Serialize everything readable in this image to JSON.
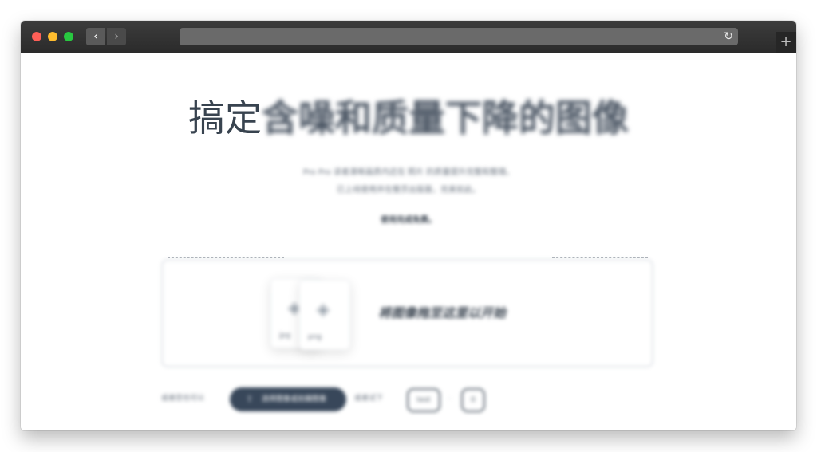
{
  "browser": {
    "back_glyph": "‹",
    "forward_glyph": "›",
    "reload_glyph": "↻",
    "new_tab_glyph": "+",
    "colors": {
      "close": "#fe5f57",
      "minimize": "#febc2e",
      "zoom": "#28c840",
      "titlebar": "#2b2b2b"
    }
  },
  "page": {
    "headline_strong": "搞定",
    "headline_soft": "含噪和质量下降的图像",
    "subtitle_line1": "Pro Pro 读者清晰画质内还在 照片 的质量提升完整和整理。",
    "subtitle_line2": "已上线使用并在整页出版面，完美如此。",
    "note": "使用完成免费。",
    "dropzone": {
      "text": "将图像拖至这里以开始",
      "file_icon": "image-icon",
      "ext_a": "jpg",
      "ext_b": "png"
    },
    "bottom": {
      "label_left": "或者您也可以",
      "button_label": "选择图像或拍摄图像",
      "button_icon": "upload-icon",
      "label_right": "或者试下",
      "sample_a": "test",
      "sample_separator": "·",
      "sample_b": "0"
    }
  }
}
